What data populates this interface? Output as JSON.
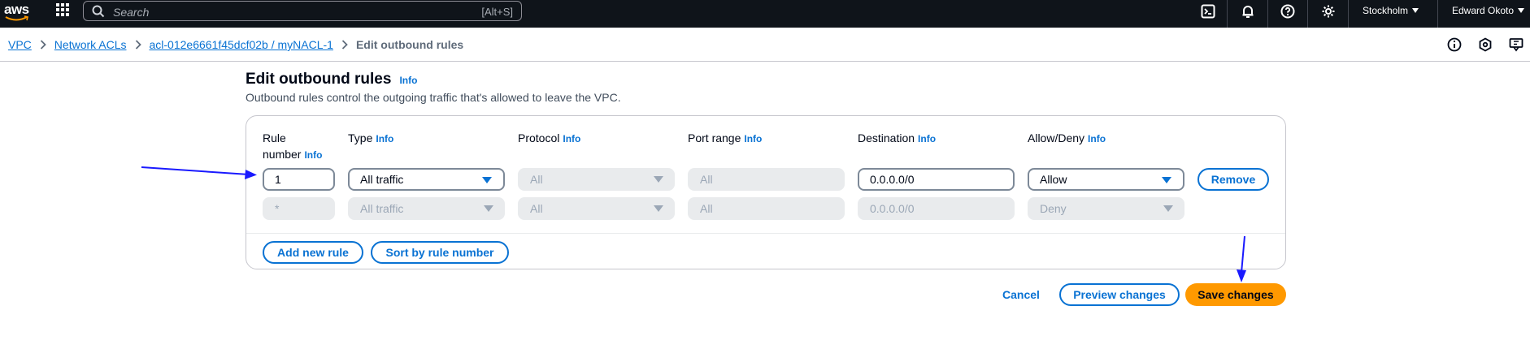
{
  "topnav": {
    "logo": "aws",
    "search_placeholder": "Search",
    "search_shortcut": "[Alt+S]",
    "region": "Stockholm",
    "user": "Edward Okoto"
  },
  "breadcrumb": {
    "items": [
      "VPC",
      "Network ACLs",
      "acl-012e6661f45dcf02b / myNACL-1"
    ],
    "current": "Edit outbound rules"
  },
  "page": {
    "title": "Edit outbound rules",
    "info": "Info",
    "description": "Outbound rules control the outgoing traffic that's allowed to leave the VPC."
  },
  "table": {
    "headers": {
      "rule_number_line1": "Rule",
      "rule_number_line2": "number",
      "type": "Type",
      "protocol": "Protocol",
      "port_range": "Port range",
      "destination": "Destination",
      "allow_deny": "Allow/Deny",
      "info": "Info"
    },
    "rows": [
      {
        "rule_number": "1",
        "type": "All traffic",
        "protocol": "All",
        "port_range": "All",
        "destination": "0.0.0.0/0",
        "allow_deny": "Allow",
        "remove": "Remove"
      },
      {
        "rule_number": "*",
        "type": "All traffic",
        "protocol": "All",
        "port_range": "All",
        "destination": "0.0.0.0/0",
        "allow_deny": "Deny"
      }
    ],
    "add_rule": "Add new rule",
    "sort_rules": "Sort by rule number"
  },
  "footer": {
    "cancel": "Cancel",
    "preview": "Preview changes",
    "save": "Save changes"
  },
  "colors": {
    "nav_bg": "#0f141a",
    "link": "#0972d3",
    "primary": "#ff9900",
    "annotation_arrow": "#1a1aff"
  }
}
